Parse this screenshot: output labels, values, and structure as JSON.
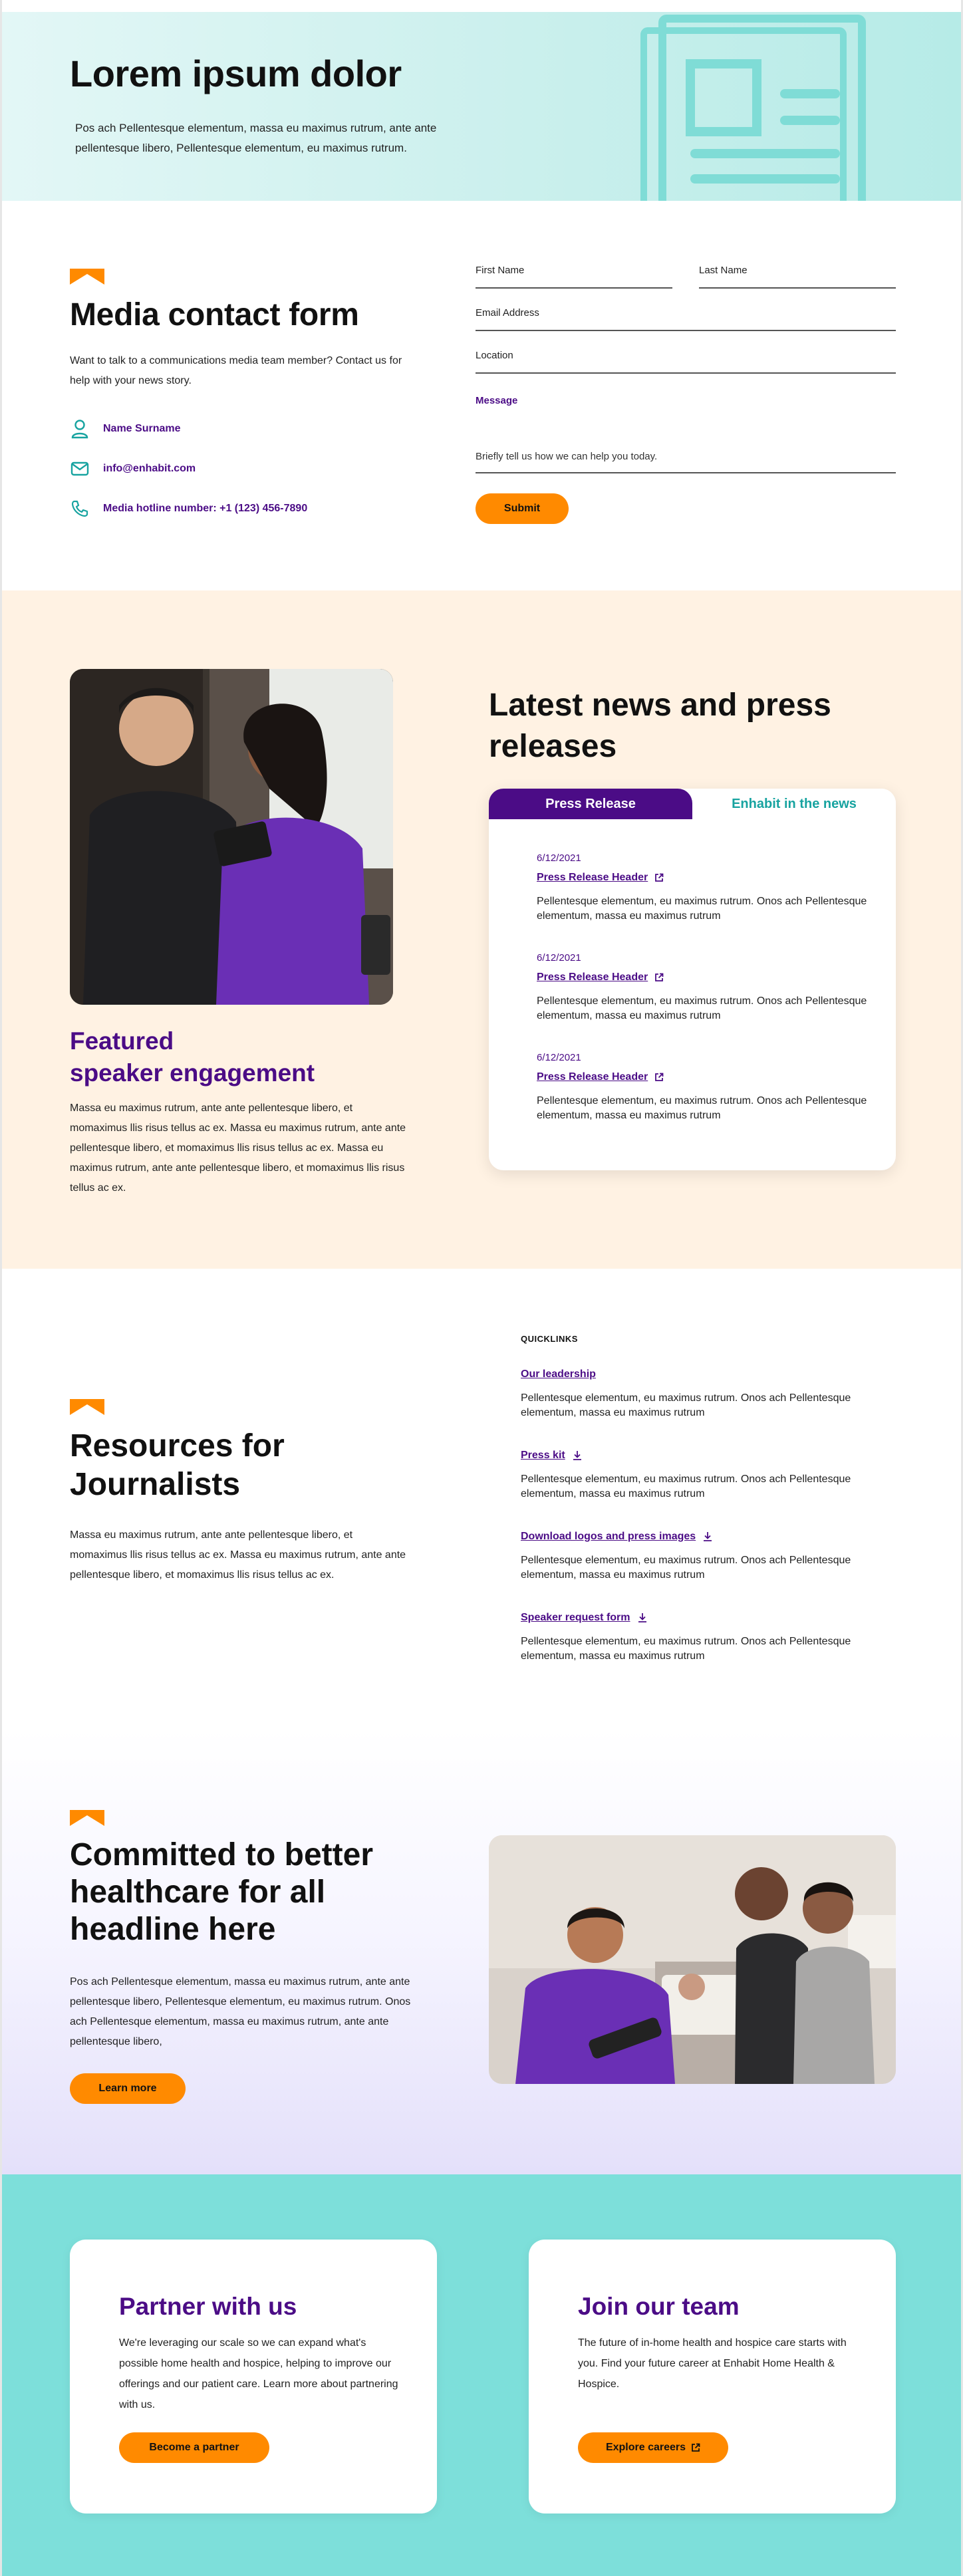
{
  "hero": {
    "title": "Lorem ipsum dolor",
    "text": "Pos ach Pellentesque elementum, massa eu maximus rutrum, ante ante pellentesque libero, Pellentesque elementum,  eu maximus rutrum."
  },
  "contact": {
    "title": "Media contact form",
    "desc": "Want to talk to a communications media team member? Contact us for help with your news story.",
    "name": "Name Surname",
    "email": "info@enhabit.com",
    "phone": "Media hotline number: +1 (123) 456-7890",
    "form": {
      "first_name": "First Name",
      "last_name": "Last Name",
      "email": "Email Address",
      "location": "Location",
      "message_label": "Message",
      "message_placeholder": "Briefly tell us how we can help you today.",
      "submit": "Submit"
    }
  },
  "featured": {
    "title_line1": "Featured",
    "title_line2": "speaker engagement",
    "text": "Massa eu maximus rutrum, ante ante pellentesque libero, et momaximus llis risus tellus ac ex. Massa eu maximus rutrum, ante ante pellentesque libero, et momaximus llis risus tellus ac ex. Massa eu maximus rutrum, ante ante pellentesque libero, et momaximus llis risus tellus ac ex."
  },
  "news": {
    "title": "Latest news and press releases",
    "tabs": [
      "Press Release",
      "Enhabit in the news"
    ],
    "items": [
      {
        "date": "6/12/2021",
        "header": "Press Release Header",
        "body": "Pellentesque elementum,  eu maximus rutrum. Onos ach Pellentesque elementum, massa eu maximus rutrum"
      },
      {
        "date": "6/12/2021",
        "header": "Press Release Header",
        "body": "Pellentesque elementum,  eu maximus rutrum. Onos ach Pellentesque elementum, massa eu maximus rutrum"
      },
      {
        "date": "6/12/2021",
        "header": "Press Release Header",
        "body": "Pellentesque elementum,  eu maximus rutrum. Onos ach Pellentesque elementum, massa eu maximus rutrum"
      }
    ]
  },
  "resources": {
    "title": "Resources for Journalists",
    "text": "Massa eu maximus rutrum, ante ante pellentesque libero, et momaximus llis risus tellus ac ex. Massa eu maximus rutrum, ante ante pellentesque libero, et momaximus llis risus tellus ac ex.",
    "quicklinks_label": "QUICKLINKS",
    "links": [
      {
        "label": "Our leadership",
        "body": "Pellentesque elementum,  eu maximus rutrum. Onos ach Pellentesque elementum, massa eu maximus rutrum"
      },
      {
        "label": "Press kit",
        "body": "Pellentesque elementum,  eu maximus rutrum. Onos ach Pellentesque elementum, massa eu maximus rutrum"
      },
      {
        "label": "Download logos and press images",
        "body": "Pellentesque elementum,  eu maximus rutrum. Onos ach Pellentesque elementum, massa eu maximus rutrum"
      },
      {
        "label": "Speaker request form",
        "body": "Pellentesque elementum,  eu maximus rutrum. Onos ach Pellentesque elementum, massa eu maximus rutrum"
      }
    ]
  },
  "committed": {
    "title": "Committed to better healthcare for all headline here",
    "text": "Pos ach Pellentesque elementum, massa eu maximus rutrum, ante ante pellentesque libero, Pellentesque elementum,  eu maximus rutrum. Onos ach Pellentesque elementum, massa eu maximus rutrum, ante ante pellentesque libero,",
    "button": "Learn more"
  },
  "cards": [
    {
      "title": "Partner with us",
      "text": "We're leveraging our scale so we can expand what's possible home health and hospice, helping to improve our offerings and our patient care. Learn more about partnering with us.",
      "button": "Become a partner"
    },
    {
      "title": "Join our team",
      "text": "The future of in-home health and hospice care starts with you. Find your future career at Enhabit Home Health & Hospice.",
      "button": "Explore careers"
    }
  ],
  "colors": {
    "purple": "#4b0c86",
    "orange": "#ff8a00",
    "teal": "#7ddfda",
    "cream": "#fff2e3"
  }
}
